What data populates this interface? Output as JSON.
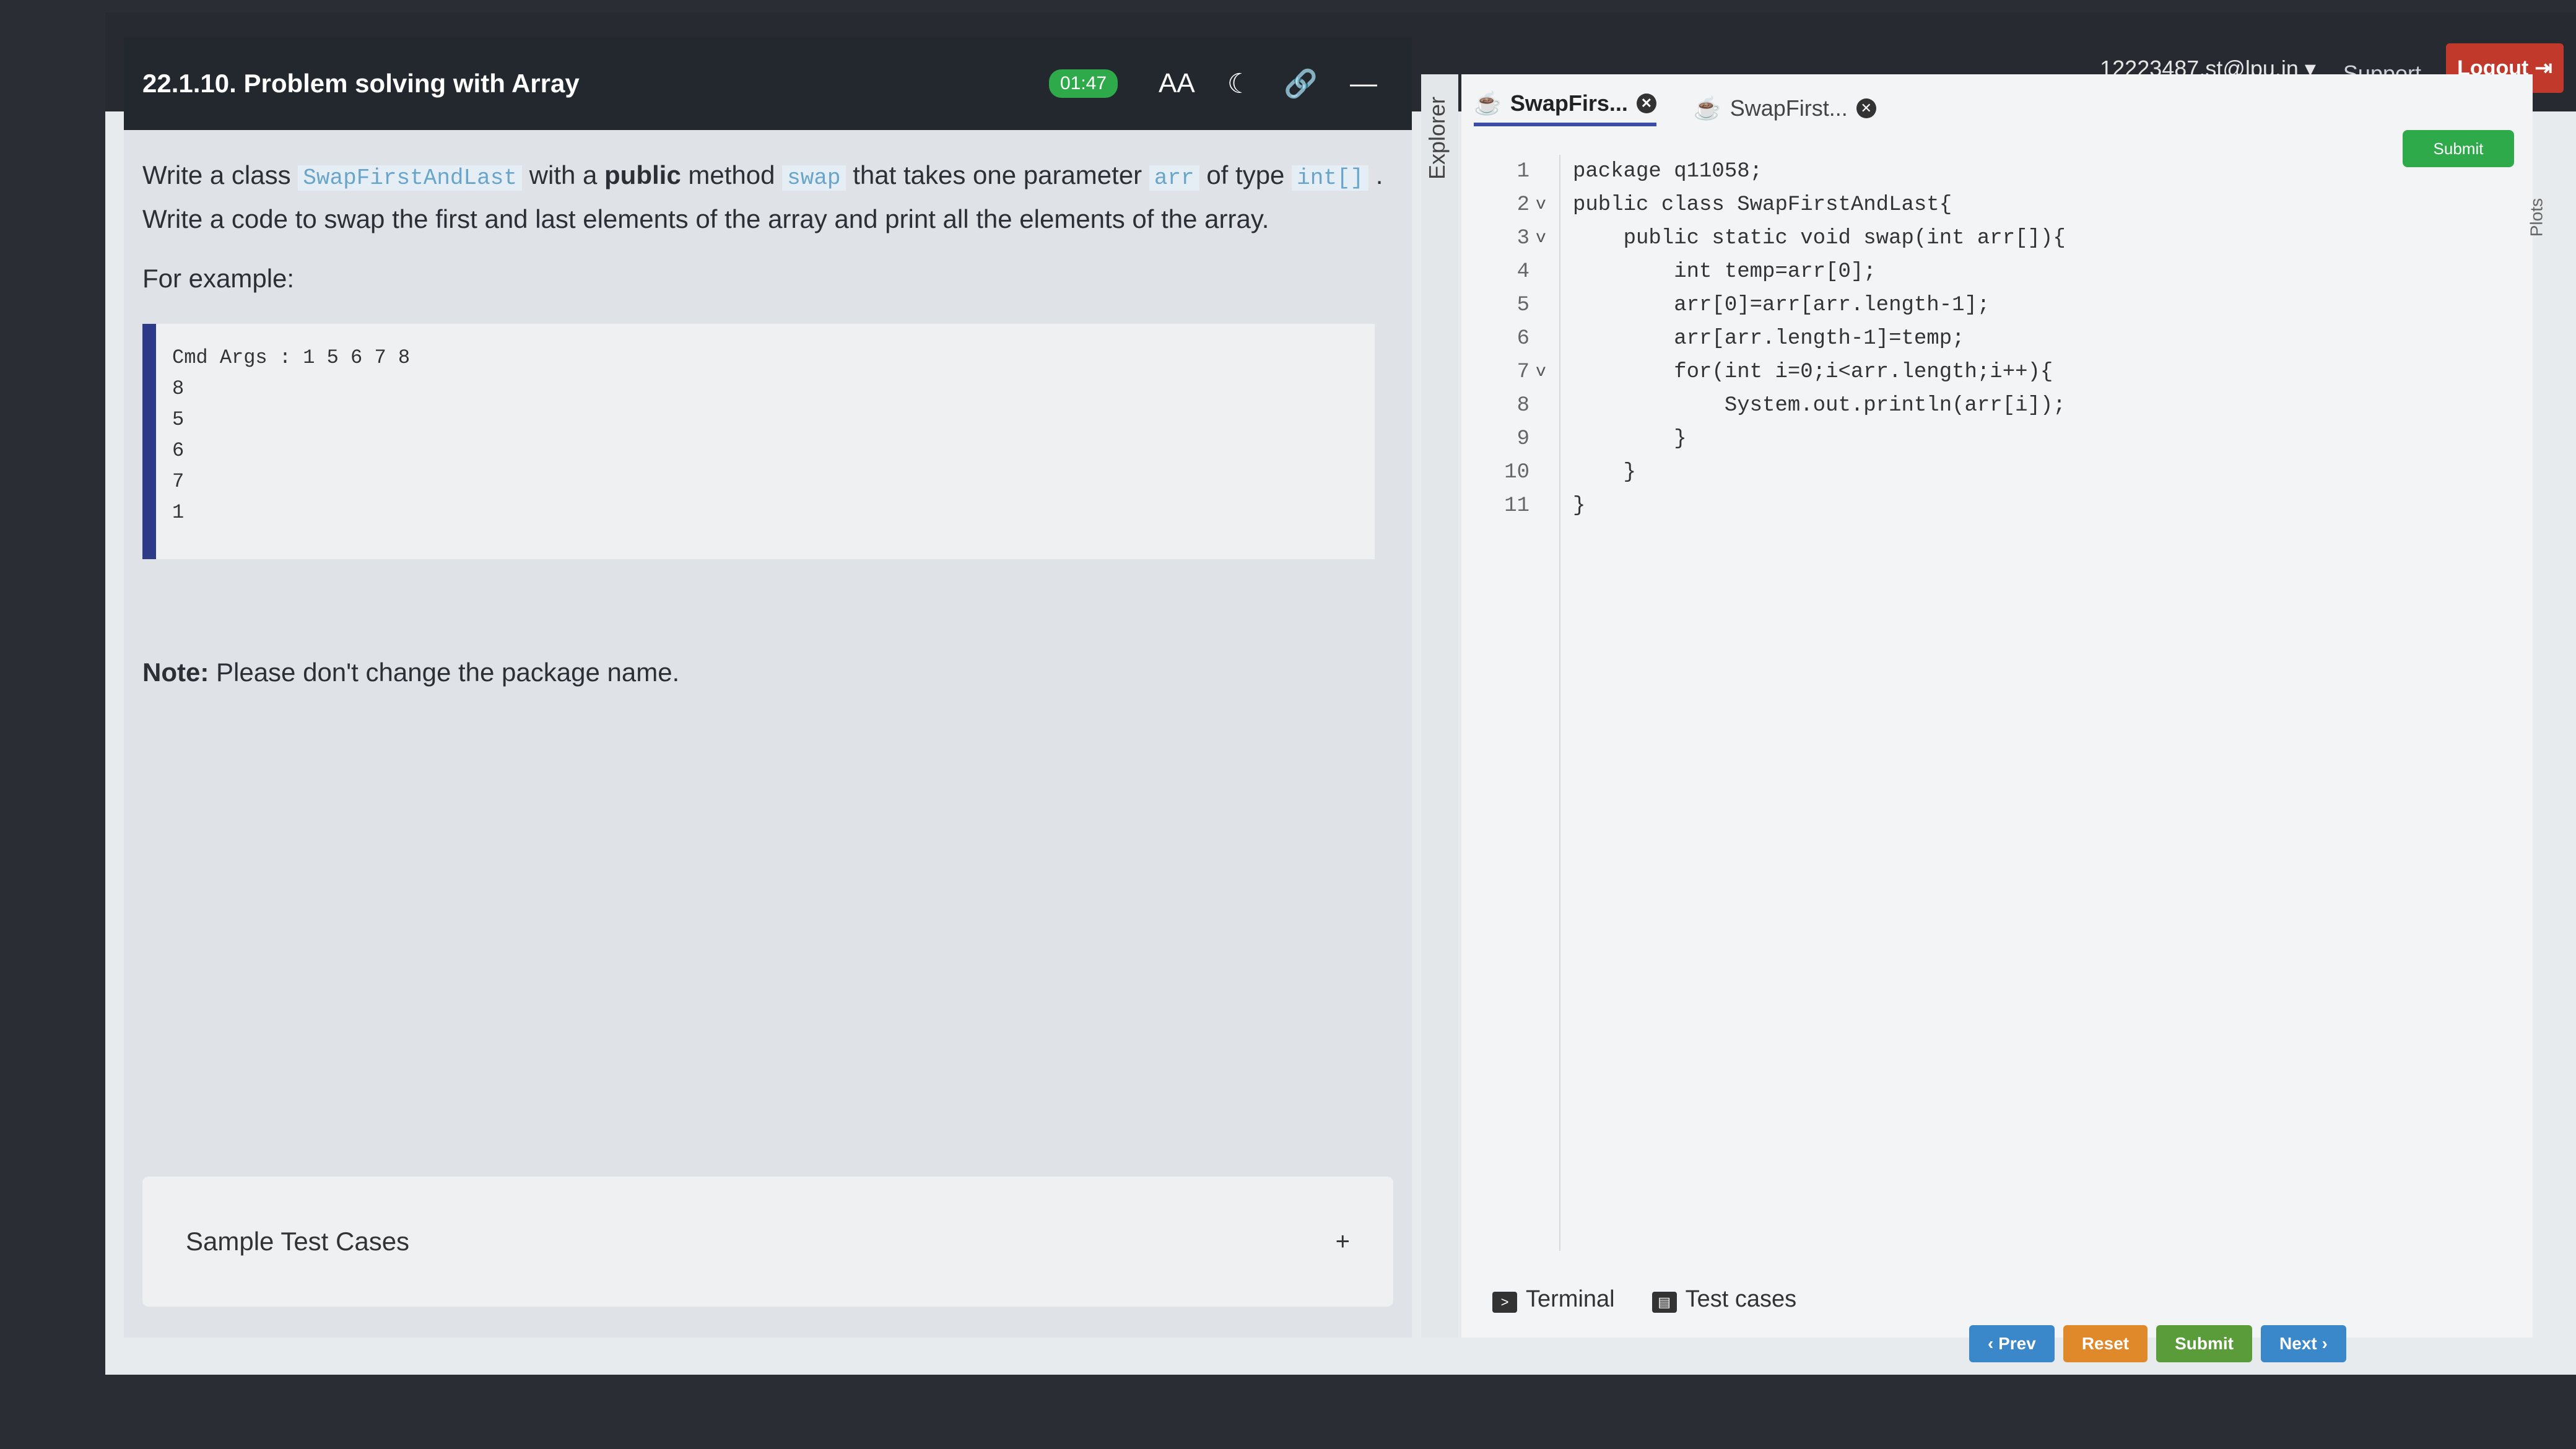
{
  "header": {
    "user": "12223487.st@lpu.in ▾",
    "support": "Support",
    "logout": "Logout"
  },
  "question": {
    "title": "22.1.10. Problem solving with Array",
    "timer": "01:47",
    "p1_a": "Write a class",
    "p1_class": "SwapFirstAndLast",
    "p1_b": "with a",
    "p1_public": "public",
    "p1_c": "method",
    "p1_method": "swap",
    "p1_d": "that takes one parameter",
    "p1_param": "arr",
    "p1_e": "of type",
    "p1_type": "int[]",
    "p1_f": ". Write a code to swap the first and last elements of the array and print all the elements of the array.",
    "example_label": "For example:",
    "example_output": "Cmd Args : 1 5 6 7 8\n8\n5\n6\n7\n1",
    "note_label": "Note:",
    "note_text": "Please don't change the package name.",
    "sample_label": "Sample Test Cases",
    "sample_plus": "+"
  },
  "explorer": {
    "label": "Explorer"
  },
  "editor": {
    "tabs": [
      {
        "label": "SwapFirs..."
      },
      {
        "label": "SwapFirst..."
      }
    ],
    "run_label": "Submit",
    "plots_label": "Plots",
    "line_numbers": "1\n2\n3\n4\n5\n6\n7\n8\n9\n10\n11",
    "fold_marks": "\nv\nv\n\n\n\nv\n\n\n\n",
    "code": "package q11058;\npublic class SwapFirstAndLast{\n    public static void swap(int arr[]){\n        int temp=arr[0];\n        arr[0]=arr[arr.length-1];\n        arr[arr.length-1]=temp;\n        for(int i=0;i<arr.length;i++){\n            System.out.println(arr[i]);\n        }\n    }\n}",
    "terminal_label": "Terminal",
    "testcases_label": "Test cases"
  },
  "nav": {
    "prev": "‹ Prev",
    "reset": "Reset",
    "submit": "Submit",
    "next": "Next ›"
  }
}
